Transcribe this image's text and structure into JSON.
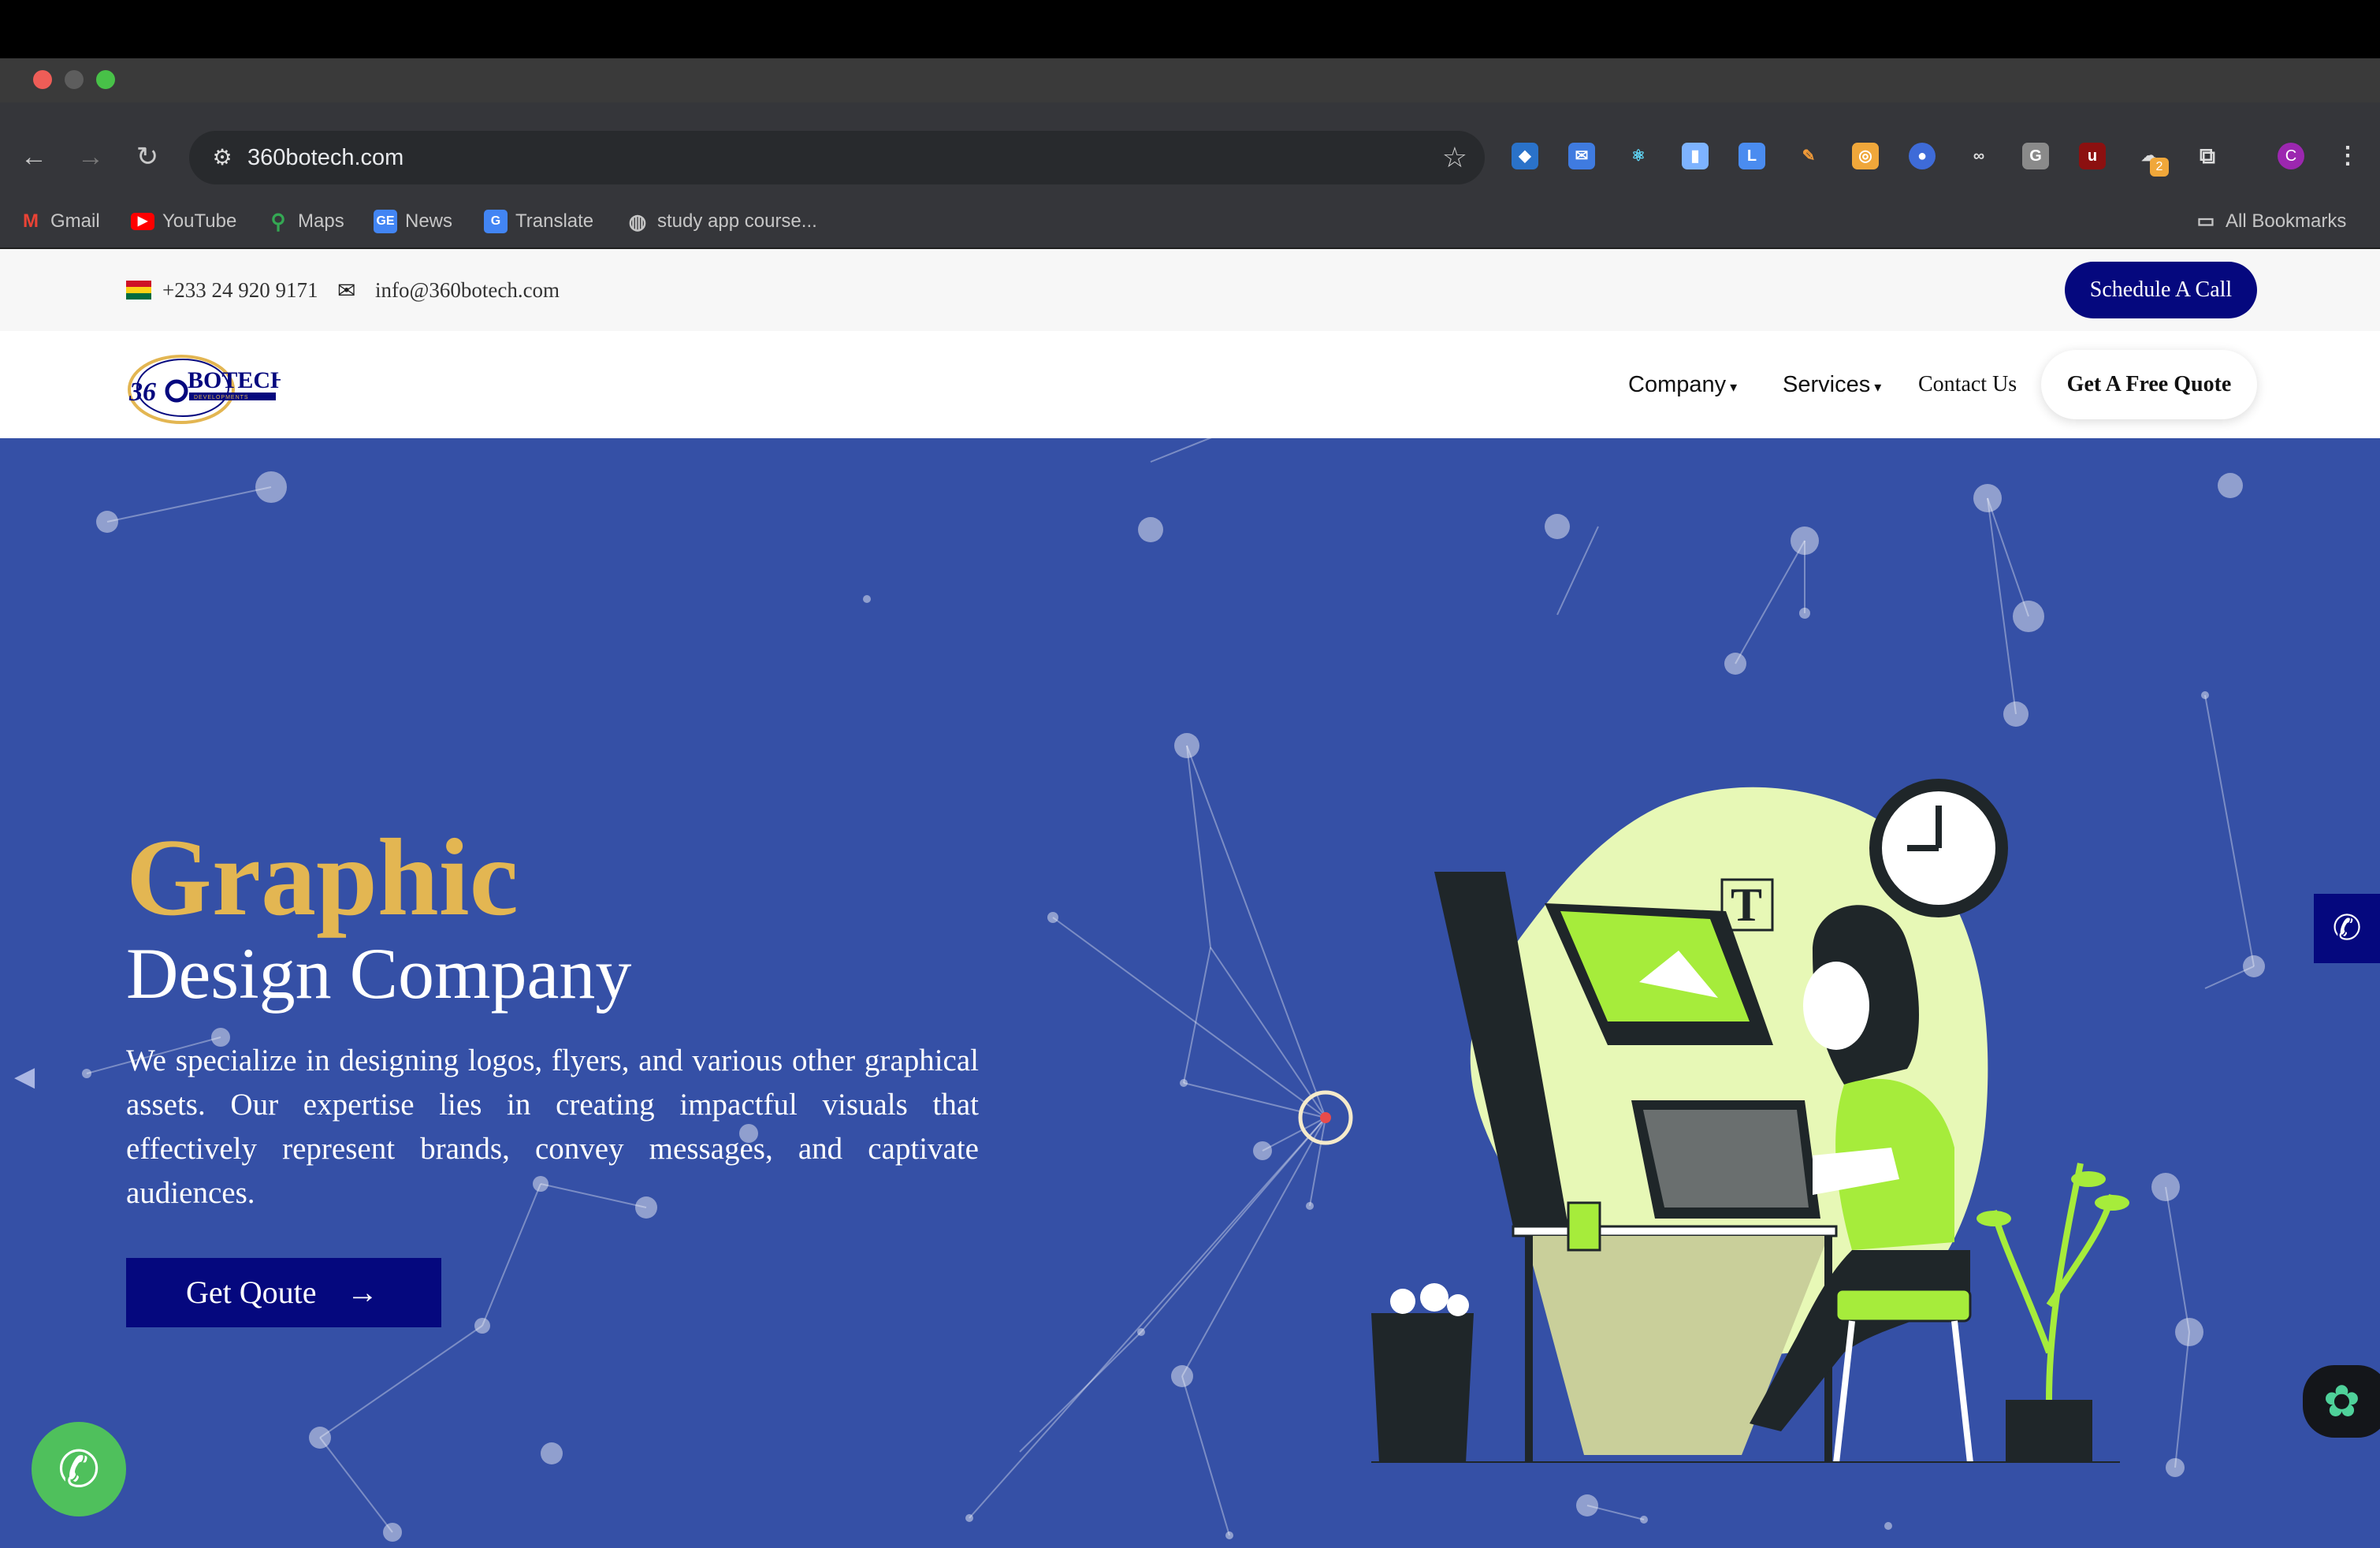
{
  "browser": {
    "url": "360botech.com",
    "bookmarks": [
      {
        "label": "Gmail",
        "icon": "gmail-icon",
        "color": "#ea4335"
      },
      {
        "label": "YouTube",
        "icon": "youtube-icon",
        "color": "#ff0000"
      },
      {
        "label": "Maps",
        "icon": "maps-icon",
        "color": "#34a853"
      },
      {
        "label": "News",
        "icon": "news-icon",
        "color": "#4285f4"
      },
      {
        "label": "Translate",
        "icon": "translate-icon",
        "color": "#4285f4"
      },
      {
        "label": "study app course...",
        "icon": "globe-icon",
        "color": "#9aa0a6"
      }
    ],
    "all_bookmarks": "All Bookmarks",
    "extensions_badge": "2",
    "profile_initial": "C"
  },
  "topbar": {
    "phone": "+233 24 920 9171",
    "email": "info@360botech.com",
    "schedule_button": "Schedule A Call"
  },
  "header": {
    "logo_text": "360BOTECH",
    "logo_sub": "DEVELOPMENTS",
    "nav": {
      "company": "Company",
      "services": "Services",
      "contact": "Contact Us"
    },
    "quote_button": "Get A Free Quote"
  },
  "hero": {
    "title": "Graphic",
    "subtitle": "Design Company",
    "body": "We specialize in designing logos, flyers, and various other graphical assets. Our expertise lies in creating impactful visuals that effectively represent brands, convey messages, and captivate audiences.",
    "cta": "Get Qoute"
  },
  "colors": {
    "hero_bg": "#3550a6",
    "accent_gold": "#e3b652",
    "brand_navy": "#05087e",
    "illustration_green": "#a6ec3b",
    "illustration_blob": "#e7f8b6"
  }
}
